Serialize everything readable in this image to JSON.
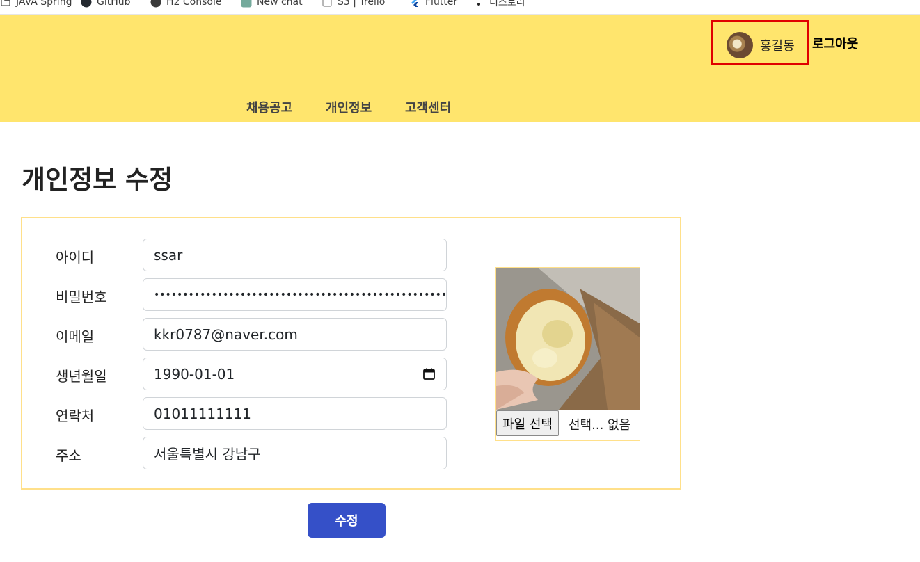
{
  "bookmarks": [
    {
      "label": "JAVA Spring",
      "icon": "folder-icon"
    },
    {
      "label": "GitHub",
      "icon": "github-icon"
    },
    {
      "label": "H2 Console",
      "icon": "h2-icon"
    },
    {
      "label": "New chat",
      "icon": "chatgpt-icon"
    },
    {
      "label": "S3 | Trello",
      "icon": "trello-icon"
    },
    {
      "label": "Flutter",
      "icon": "flutter-icon"
    },
    {
      "label": "티스토리",
      "icon": "tistory-icon"
    }
  ],
  "header": {
    "user_name": "홍길동",
    "logout_label": "로그아웃",
    "nav": [
      "채용공고",
      "개인정보",
      "고객센터"
    ],
    "background": "#ffe56d",
    "highlight_color": "#e00000"
  },
  "page": {
    "title": "개인정보 수정"
  },
  "form": {
    "fields": [
      {
        "label": "아이디",
        "value": "ssar",
        "type": "text"
      },
      {
        "label": "비밀번호",
        "value": "••••••••••••••••••••••••••••••••••••••••••••••••••••••••••••",
        "type": "password"
      },
      {
        "label": "이메일",
        "value": "kkr0787@naver.com",
        "type": "email"
      },
      {
        "label": "생년월일",
        "value": "1990-01-01",
        "type": "date"
      },
      {
        "label": "연락처",
        "value": "01011111111",
        "type": "tel"
      },
      {
        "label": "주소",
        "value": "서울특별시 강남구",
        "type": "text"
      }
    ],
    "file_button_label": "파일 선택",
    "file_status": "선택... 없음",
    "submit_label": "수정",
    "submit_color": "#3550c8"
  }
}
